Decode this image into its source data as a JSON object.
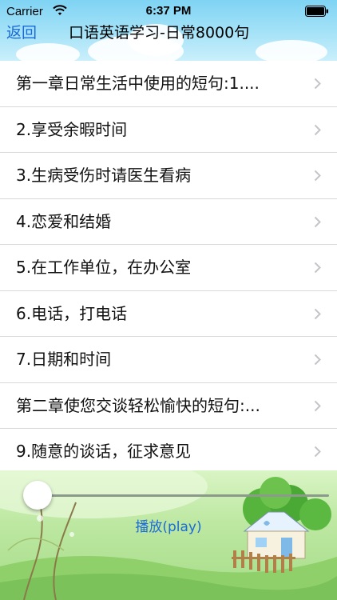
{
  "status_bar": {
    "carrier": "Carrier",
    "time": "6:37 PM"
  },
  "nav": {
    "back_label": "返回",
    "title": "口语英语学习-日常8000句"
  },
  "list": {
    "items": [
      {
        "label": "第一章日常生活中使用的短句:1...."
      },
      {
        "label": "2.享受余暇时间"
      },
      {
        "label": "3.生病受伤时请医生看病"
      },
      {
        "label": "4.恋爱和结婚"
      },
      {
        "label": "5.在工作单位，在办公室"
      },
      {
        "label": "6.电话，打电话"
      },
      {
        "label": "7.日期和时间"
      },
      {
        "label": "第二章使您交谈轻松愉快的短句:..."
      },
      {
        "label": "9.随意的谈话，征求意见"
      }
    ]
  },
  "player": {
    "play_label": "播放(play)",
    "progress": 0
  },
  "colors": {
    "accent": "#1a6ad8",
    "header_sky": "#7fd3f4",
    "grass": "#a6dc88"
  },
  "icons": {
    "wifi": "wifi-icon",
    "battery": "battery-icon",
    "chevron": "chevron-right-icon"
  }
}
